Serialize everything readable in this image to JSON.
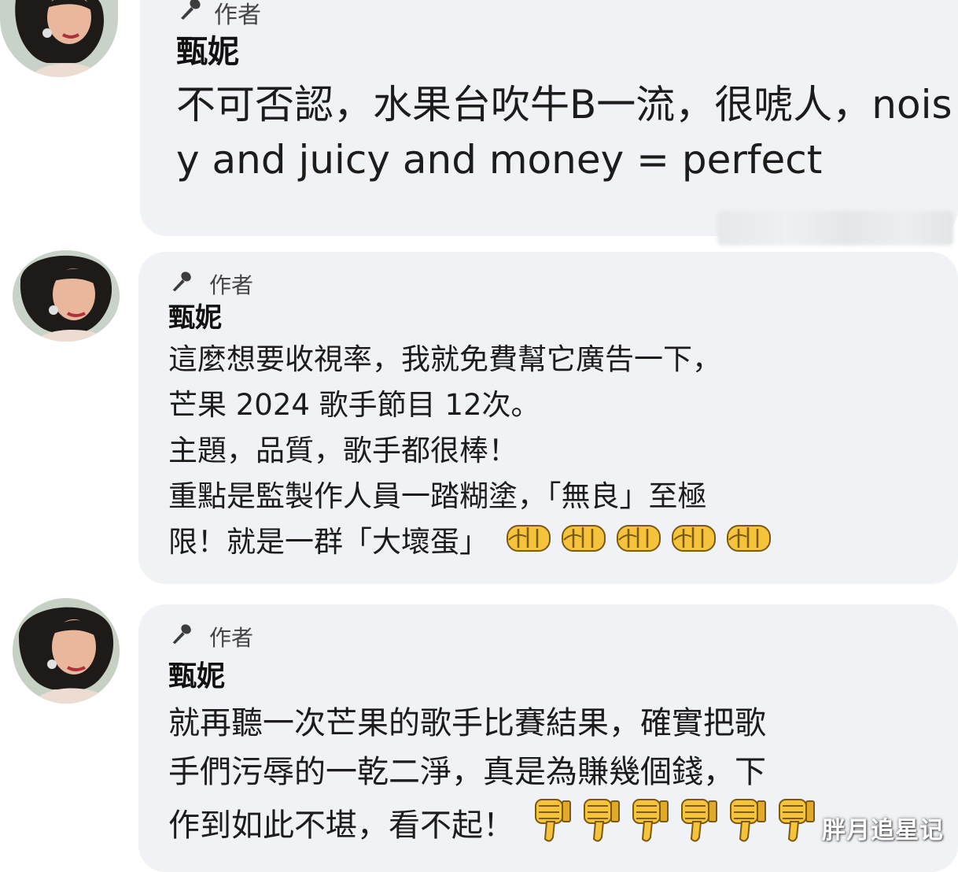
{
  "comments": [
    {
      "badge": "作者",
      "name": "甄妮",
      "text": "不可否認，水果台吹牛B一流，很唬人，noisy and juicy and money = perfect",
      "emoji_count": 0
    },
    {
      "badge": "作者",
      "name": "甄妮",
      "lines": [
        "這麼想要收視率，我就免費幫它廣告一下，",
        "芒果 2024 歌手節目 12次。",
        "主題，品質，歌手都很棒！",
        "重點是監製作人員一踏糊塗，「無良」至極",
        "限！就是一群「大壞蛋」"
      ],
      "emoji": "oncoming-fist-icon",
      "emoji_count": 5
    },
    {
      "badge": "作者",
      "name": "甄妮",
      "lines": [
        "就再聽一次芒果的歌手比賽結果，確實把歌",
        "手們污辱的一乾二淨，真是為賺幾個錢，下",
        "作到如此不堪，看不起！"
      ],
      "emoji": "thumbs-down-icon",
      "emoji_count": 6
    }
  ],
  "watermark": "胖月追星记",
  "colors": {
    "bubble": "#f0f2f5",
    "text": "#1c1c1c",
    "emoji_yellow": "#f6c33c"
  }
}
